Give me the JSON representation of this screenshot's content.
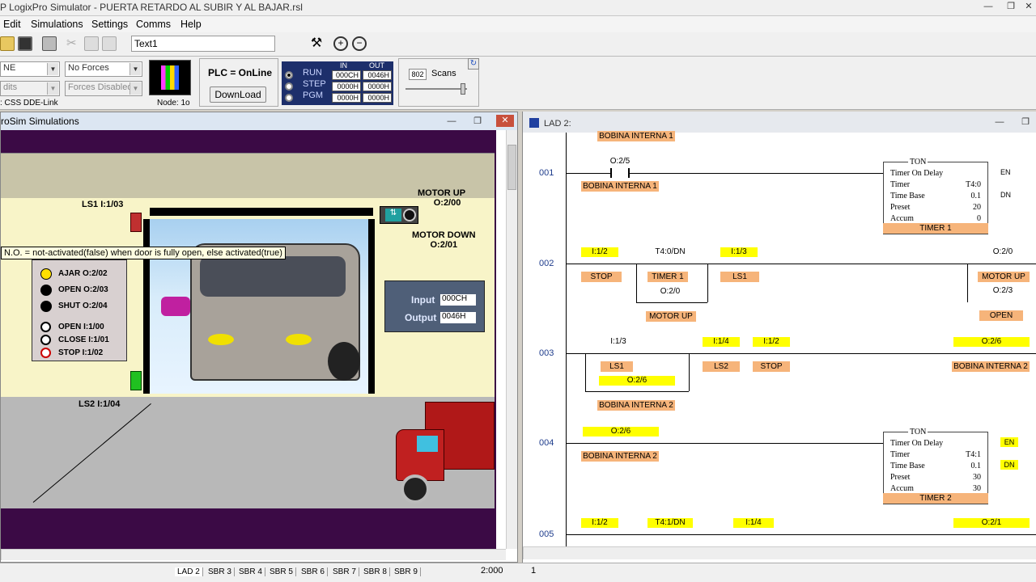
{
  "window": {
    "title": "P LogixPro Simulator  -  PUERTA RETARDO AL SUBIR Y AL BAJAR.rsl"
  },
  "menu": [
    "Edit",
    "Simulations",
    "Settings",
    "Comms",
    "Help"
  ],
  "toolbar": {
    "text_value": "Text1"
  },
  "status": {
    "mode_value": "NE",
    "edits_value": "dits",
    "forces_value": "No Forces",
    "forces_disabled": "Forces Disabled",
    "dde_label": ": CSS DDE-Link",
    "node_label": "Node: 1o",
    "plc_status": "PLC = OnLine",
    "download_label": "DownLoad",
    "run_label": "RUN",
    "step_label": "STEP",
    "pgm_label": "PGM",
    "in_header": "IN",
    "out_header": "OUT",
    "in_values": [
      "000CH",
      "0000H",
      "0000H"
    ],
    "out_values": [
      "0046H",
      "0000H",
      "0000H"
    ],
    "scans_value": "802",
    "scans_label": "Scans"
  },
  "sim_window": {
    "title": "roSim Simulations",
    "ls1": "LS1   I:1/03",
    "ls2": "LS2   I:1/04",
    "motor_up_1": "MOTOR UP",
    "motor_up_2": "O:2/00",
    "motor_down_1": "MOTOR DOWN",
    "motor_down_2": "O:2/01",
    "tooltip": "N.O. = not-activated(false) when door is fully open, else activated(true)",
    "panel": {
      "ajar": "AJAR  O:2/02",
      "open_out": "OPEN  O:2/03",
      "shut": "SHUT  O:2/04",
      "open_in": "OPEN    I:1/00",
      "close_in": "CLOSE I:1/01",
      "stop_in": "STOP    I:1/02"
    },
    "io_input_label": "Input",
    "io_input_value": "000CH",
    "io_output_label": "Output",
    "io_output_value": "0046H"
  },
  "ladder": {
    "title": "LAD 2:",
    "top_label": "BOBINA INTERNA 1",
    "rungs": [
      "001",
      "002",
      "003",
      "004",
      "005"
    ],
    "r1": {
      "addr": "O:2/5",
      "name": "BOBINA INTERNA 1",
      "ton": "TON",
      "ton_title": "Timer On Delay",
      "timer_l": "Timer",
      "timer_v": "T4:0",
      "base_l": "Time Base",
      "base_v": "0.1",
      "preset_l": "Preset",
      "preset_v": "20",
      "accum_l": "Accum",
      "accum_v": "0",
      "tname": "TIMER 1",
      "en": "EN",
      "dn": "DN"
    },
    "r2": {
      "c1": "I:1/2",
      "c1n": "STOP",
      "c2": "T4:0/DN",
      "c2n": "TIMER 1",
      "c3": "I:1/3",
      "c3n": "LS1",
      "c4": "O:2/0",
      "c4n": "MOTOR UP",
      "o1": "O:2/0",
      "o1n": "MOTOR UP",
      "o2": "O:2/3",
      "o2n": "OPEN"
    },
    "r3": {
      "c1": "I:1/3",
      "c1n": "LS1",
      "c2": "I:1/4",
      "c2n": "LS2",
      "c3": "I:1/2",
      "c3n": "STOP",
      "c4": "O:2/6",
      "c4n": "BOBINA INTERNA 2",
      "o1": "O:2/6",
      "o1n": "BOBINA INTERNA 2"
    },
    "r4": {
      "addr": "O:2/6",
      "name": "BOBINA INTERNA 2",
      "ton": "TON",
      "ton_title": "Timer On Delay",
      "timer_l": "Timer",
      "timer_v": "T4:1",
      "base_l": "Time Base",
      "base_v": "0.1",
      "preset_l": "Preset",
      "preset_v": "30",
      "accum_l": "Accum",
      "accum_v": "30",
      "tname": "TIMER 2",
      "en": "EN",
      "dn": "DN"
    },
    "r5": {
      "c1": "I:1/2",
      "c2": "T4:1/DN",
      "c3": "I:1/4",
      "o1": "O:2/1"
    }
  },
  "tabs": [
    "LAD 2",
    "SBR 3",
    "SBR 4",
    "SBR 5",
    "SBR 6",
    "SBR 7",
    "SBR 8",
    "SBR 9"
  ],
  "statusline": {
    "pos": "2:000",
    "num": "1"
  }
}
